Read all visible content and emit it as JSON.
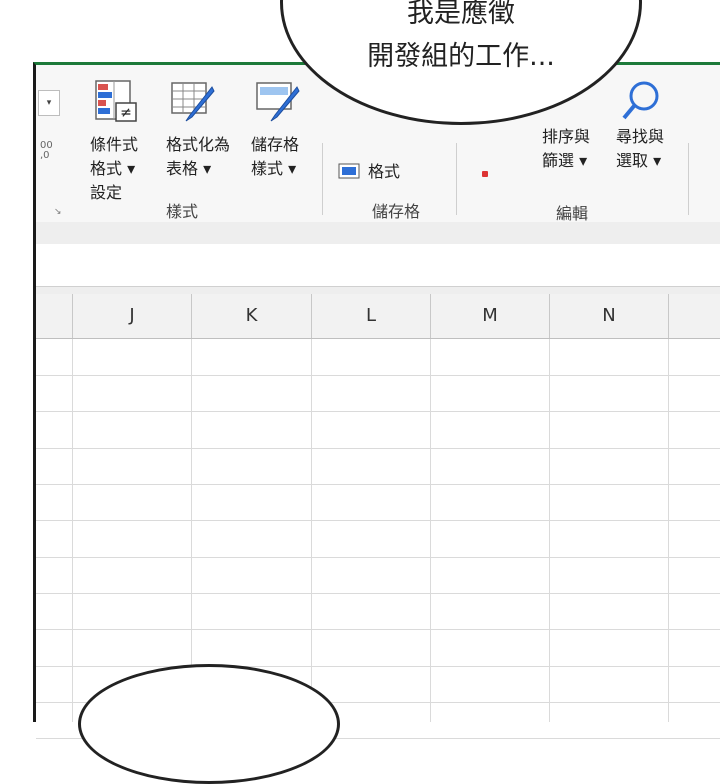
{
  "speech_bubble": {
    "line1": "我是應徵",
    "line2": "開發組的工作..."
  },
  "ribbon": {
    "dropdown_stub": "▾",
    "numfmt_stub_top": "00",
    "numfmt_stub_bottom": ",0",
    "launcher": "↘",
    "buttons": [
      {
        "id": "conditional-formatting",
        "label": "條件式\n格式 ▾\n設定",
        "icon": "conditional-formatting-icon"
      },
      {
        "id": "format-as-table",
        "label": "格式化為\n表格 ▾",
        "icon": "format-as-table-icon"
      },
      {
        "id": "cell-styles",
        "label": "儲存格\n樣式 ▾",
        "icon": "cell-styles-icon"
      },
      {
        "id": "sort-filter",
        "label": "排序與\n篩選 ▾",
        "icon": "sort-filter-icon"
      },
      {
        "id": "find-select",
        "label": "尋找與\n選取 ▾",
        "icon": "find-select-icon"
      }
    ],
    "cells_format_label": "格式",
    "groups": {
      "styles": "樣式",
      "cells": "儲存格",
      "editing": "編輯"
    }
  },
  "sheet": {
    "columns": [
      "J",
      "K",
      "L",
      "M",
      "N"
    ]
  },
  "colors": {
    "accent_green": "#1d7a3a",
    "ribbon_bg": "#f7f7f7",
    "header_bg": "#f2f2f2",
    "grid_line": "#dadada"
  }
}
